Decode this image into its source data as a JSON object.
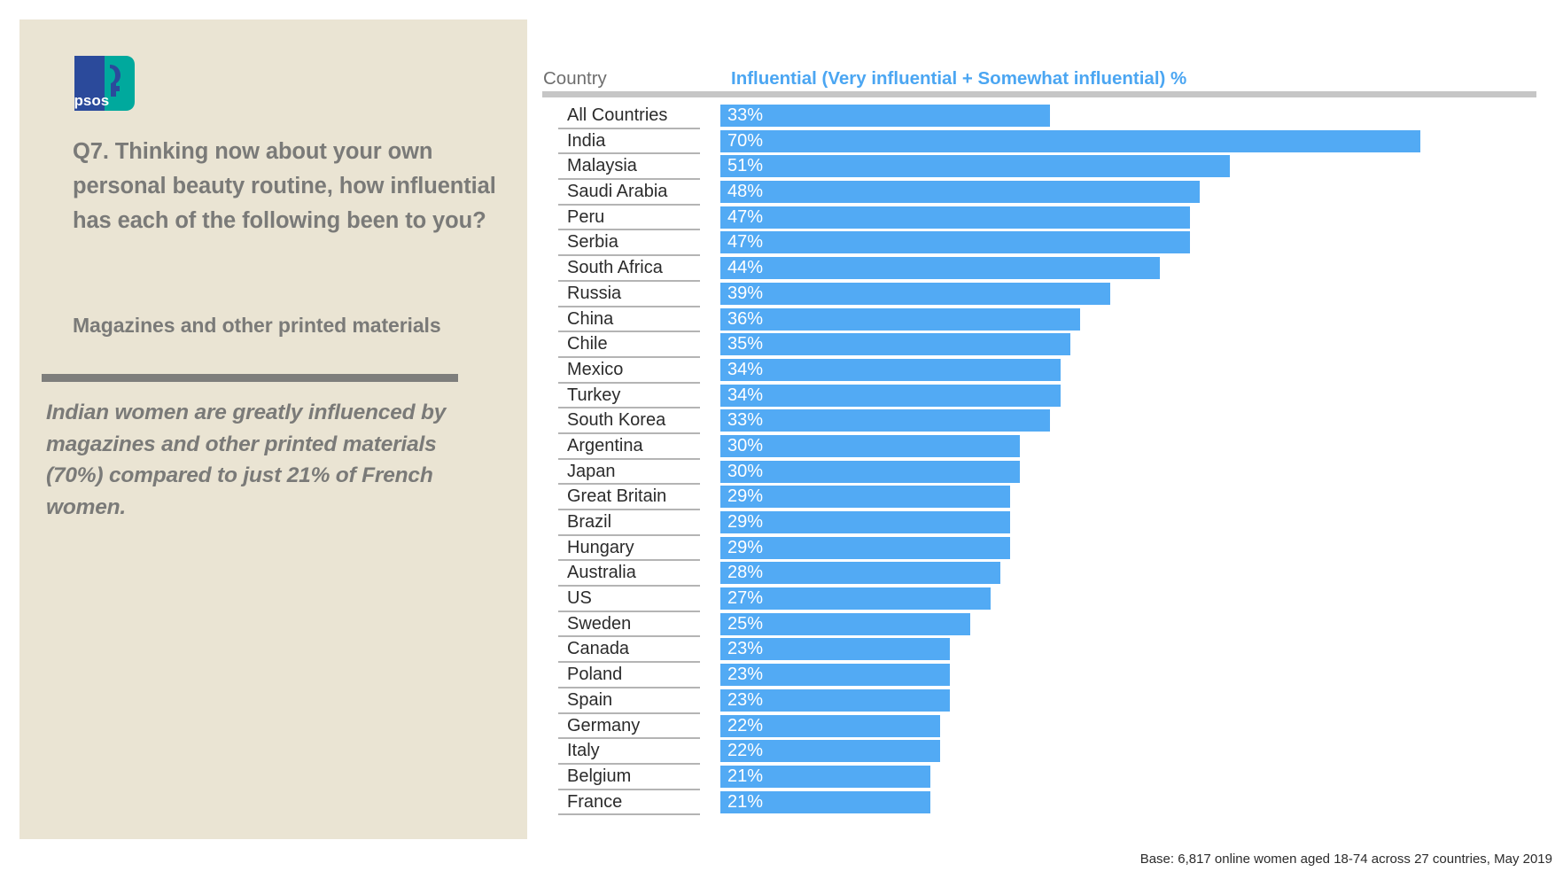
{
  "brand": {
    "logo_name": "ipsos-logo",
    "logo_text": "Ipsos",
    "logo_blue": "#2B4A9B",
    "logo_teal": "#00A99D"
  },
  "panel": {
    "background": "#EAE4D3",
    "question": "Q7. Thinking now about your own personal beauty routine, how influential has each of the following been to you?",
    "subject": "Magazines and other printed materials",
    "insight": "Indian women are greatly influenced by magazines and other printed materials (70%) compared to just 21% of French women.",
    "text_color": "#7A7A78",
    "rule_color": "#7E7E7C"
  },
  "chart_data": {
    "type": "bar",
    "orientation": "horizontal",
    "title": "",
    "xlabel": "",
    "ylabel": "Country",
    "column_headers": {
      "category": "Country",
      "value": "Influential (Very influential + Somewhat influential) %"
    },
    "accent_color": "#52AAF4",
    "header_color": "#4BA6F2",
    "grid": false,
    "legend": "none",
    "xlim": [
      0,
      100
    ],
    "unit": "%",
    "categories": [
      "All Countries",
      "India",
      "Malaysia",
      "Saudi Arabia",
      "Peru",
      "Serbia",
      "South Africa",
      "Russia",
      "China",
      "Chile",
      "Mexico",
      "Turkey",
      "South Korea",
      "Argentina",
      "Japan",
      "Great Britain",
      "Brazil",
      "Hungary",
      "Australia",
      "US",
      "Sweden",
      "Canada",
      "Poland",
      "Spain",
      "Germany",
      "Italy",
      "Belgium",
      "France"
    ],
    "values": [
      33,
      70,
      51,
      48,
      47,
      47,
      44,
      39,
      36,
      35,
      34,
      34,
      33,
      30,
      30,
      29,
      29,
      29,
      28,
      27,
      25,
      23,
      23,
      23,
      22,
      22,
      21,
      21
    ],
    "value_labels": [
      "33%",
      "70%",
      "51%",
      "48%",
      "47%",
      "47%",
      "44%",
      "39%",
      "36%",
      "35%",
      "34%",
      "34%",
      "33%",
      "30%",
      "30%",
      "29%",
      "29%",
      "29%",
      "28%",
      "27%",
      "25%",
      "23%",
      "23%",
      "23%",
      "22%",
      "22%",
      "21%",
      "21%"
    ]
  },
  "footer": {
    "base_note": "Base: 6,817 online women aged 18-74 across 27 countries,  May 2019"
  }
}
